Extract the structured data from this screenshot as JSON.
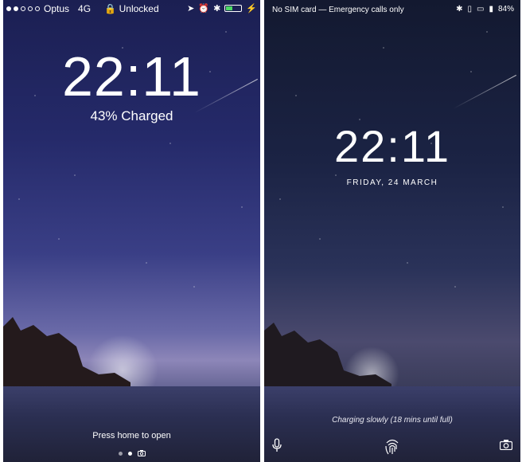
{
  "ios": {
    "status": {
      "carrier": "Optus",
      "network": "4G",
      "lock_status": "Unlocked",
      "battery_level": 0.43,
      "colors": {
        "battery": "#4cd964"
      },
      "icons": [
        "lock-icon",
        "location-arrow-icon",
        "alarm-icon",
        "bluetooth-icon",
        "battery-icon",
        "charging-bolt-icon"
      ]
    },
    "time": "22:11",
    "subtitle": "43% Charged",
    "hint": "Press home to open",
    "pager": {
      "count": 2,
      "active": 1,
      "extra_icon": "camera-icon"
    }
  },
  "android": {
    "status": {
      "message": "No SIM card — Emergency calls only",
      "battery_percent": "84%",
      "icons": [
        "bluetooth-icon",
        "vibrate-icon",
        "no-sim-icon",
        "battery-icon"
      ]
    },
    "time": "22:11",
    "date": "FRIDAY, 24 MARCH",
    "charging": "Charging slowly (18 mins until full)",
    "bottom_icons": [
      "microphone-icon",
      "fingerprint-icon",
      "camera-icon"
    ]
  }
}
